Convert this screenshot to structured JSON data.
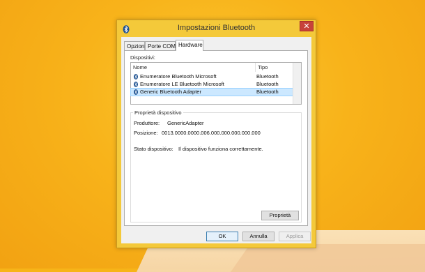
{
  "window": {
    "title": "Impostazioni Bluetooth",
    "close_label": "✕"
  },
  "tabs": [
    {
      "label": "Opzioni",
      "active": false
    },
    {
      "label": "Porte COM",
      "active": false
    },
    {
      "label": "Hardware",
      "active": true
    }
  ],
  "devices_section": {
    "label": "Dispositivi:",
    "columns": {
      "name": "Nome",
      "type": "Tipo"
    },
    "rows": [
      {
        "name": "Enumeratore Bluetooth Microsoft",
        "type": "Bluetooth",
        "selected": false
      },
      {
        "name": "Enumeratore LE Bluetooth Microsoft",
        "type": "Bluetooth",
        "selected": false
      },
      {
        "name": "Generic Bluetooth Adapter",
        "type": "Bluetooth",
        "selected": true
      }
    ]
  },
  "properties_section": {
    "label": "Proprietà dispositivo",
    "manufacturer_label": "Produttore:",
    "manufacturer_value": "GenericAdapter",
    "position_label": "Posizione:",
    "position_value": "0013.0000.0000.006.000.000.000.000.000",
    "status_label": "Stato dispositivo:",
    "status_value": "Il dispositivo funziona correttamente.",
    "properties_button": "Proprietà"
  },
  "buttons": {
    "ok": "OK",
    "cancel": "Annulla",
    "apply": "Applica"
  },
  "icons": {
    "device": "bluetooth-icon",
    "title": "bluetooth-icon"
  },
  "colors": {
    "selection": "#cce8ff",
    "close": "#c7423a",
    "window_frame": "#f4c93a"
  }
}
